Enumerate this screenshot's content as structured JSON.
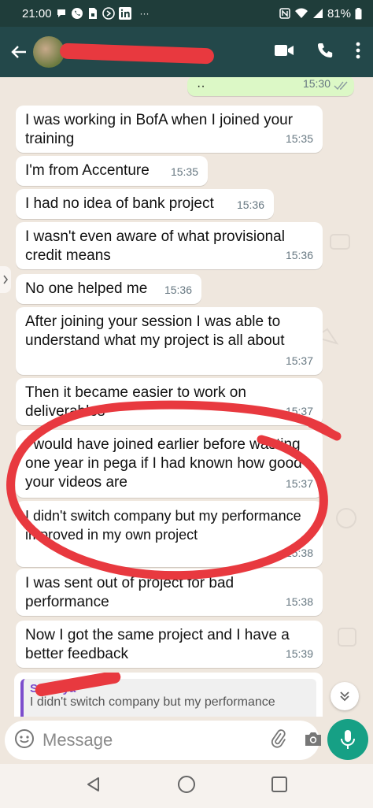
{
  "status_bar": {
    "time": "21:00",
    "more": "···",
    "battery": "81%"
  },
  "header": {
    "contact_name": ""
  },
  "messages": [
    {
      "text": "··",
      "time": "15:30",
      "direction": "out"
    },
    {
      "text": "I was working in BofA when I joined your training",
      "time": "15:35",
      "direction": "in"
    },
    {
      "text": "I'm from Accenture",
      "time": "15:35",
      "direction": "in"
    },
    {
      "text": "I had no idea of bank project",
      "time": "15:36",
      "direction": "in"
    },
    {
      "text": "I wasn't even aware of what provisional credit means",
      "time": "15:36",
      "direction": "in"
    },
    {
      "text": "No one helped me",
      "time": "15:36",
      "direction": "in"
    },
    {
      "text": "After joining your session I was able to understand what my project is all about",
      "time": "15:37",
      "direction": "in"
    },
    {
      "text": "Then it became easier to work on deliverables",
      "time": "15:37",
      "direction": "in"
    },
    {
      "text": "I would have joined earlier before wasting one year in pega if I had known how good your videos are",
      "time": "15:37",
      "direction": "in"
    },
    {
      "text": "I didn't switch company but my performance improved in my own project",
      "time": "15:38",
      "direction": "in"
    },
    {
      "text": "I was sent out of project for bad performance",
      "time": "15:38",
      "direction": "in"
    },
    {
      "text": "Now I got the same project and I have a better feedback",
      "time": "15:39",
      "direction": "in"
    }
  ],
  "reply_preview": {
    "author": "Soumya",
    "text": "I didn't switch company but my performance"
  },
  "input": {
    "placeholder": "Message"
  },
  "colors": {
    "header": "#23484a",
    "status_bar": "#1f3d3a",
    "mic_button": "#16a085",
    "annotation": "#e8393f",
    "outgoing_bubble": "#dcf8c6"
  }
}
